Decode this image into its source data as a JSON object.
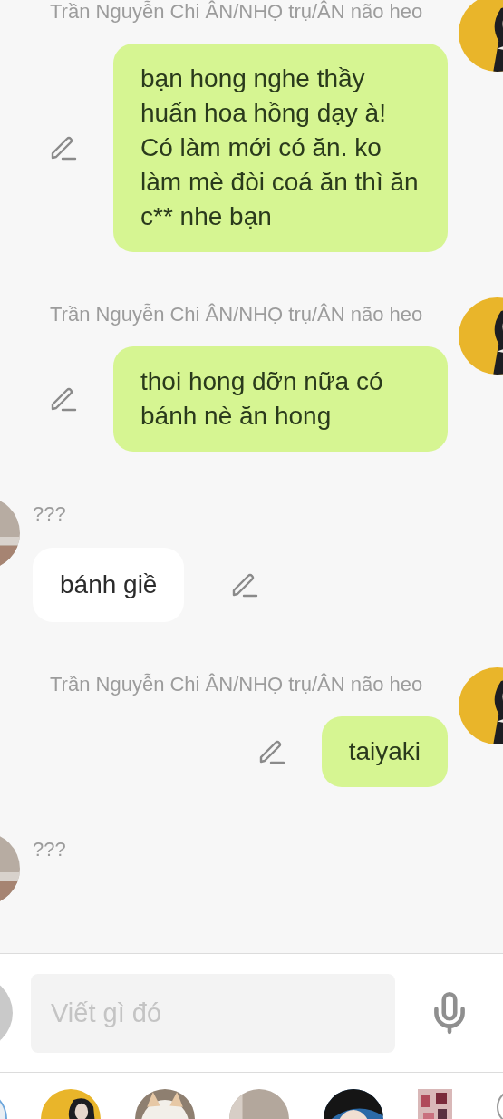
{
  "messages": [
    {
      "kind": "sent",
      "sender": "Trần Nguyễn Chi ÂN/NHỌ trụ/ÂN não heo",
      "text": "bạn hong nghe thầy huấn hoa hồng dạy à! Có làm mới có ăn. ko làm mè đòi coá ăn thì ăn c** nhe bạn"
    },
    {
      "kind": "sent",
      "sender": "Trần Nguyễn Chi ÂN/NHỌ trụ/ÂN não heo",
      "text": "thoi hong dỡn nữa có bánh nè  ăn hong"
    },
    {
      "kind": "received",
      "sender": "???",
      "text": "bánh giề"
    },
    {
      "kind": "sent",
      "sender": "Trần Nguyễn Chi ÂN/NHỌ trụ/ÂN não heo",
      "text": "taiyaki"
    },
    {
      "kind": "received",
      "sender": "???"
    }
  ],
  "composer": {
    "placeholder": "Viết gì đó"
  }
}
